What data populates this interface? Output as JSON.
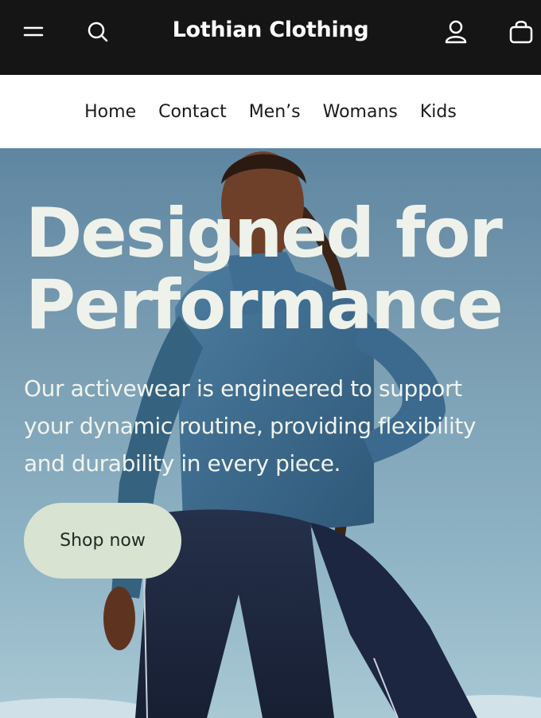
{
  "header": {
    "brand": "Lothian Clothing",
    "icons": [
      "menu-icon",
      "search-icon",
      "account-icon",
      "bag-icon"
    ]
  },
  "nav": {
    "items": [
      "Home",
      "Contact",
      "Men’s",
      "Womans",
      "Kids"
    ]
  },
  "hero": {
    "title_line1": "Designed for",
    "title_line2": "Performance",
    "description": "Our activewear is engineered to support your dynamic routine, providing flexibility and durability in every piece.",
    "cta_label": "Shop now"
  },
  "colors": {
    "header_bg": "#151515",
    "cta_bg": "#d8e3d2",
    "hero_text": "#eef2ea",
    "sky": "#7a9db2",
    "jacket": "#3c6a8e",
    "leggings": "#1f2a44"
  }
}
